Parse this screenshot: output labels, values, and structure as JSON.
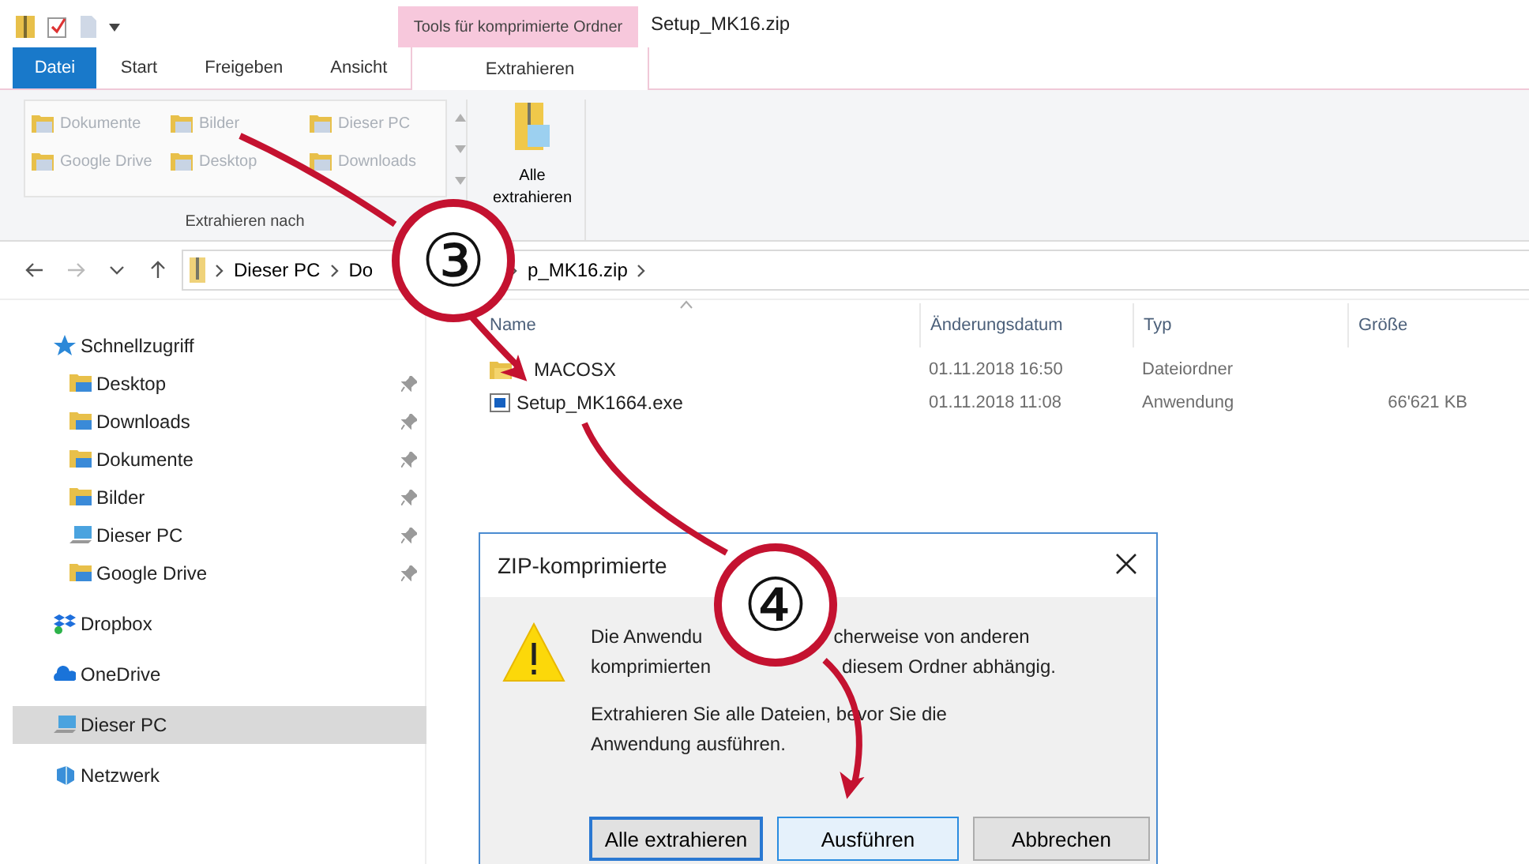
{
  "ribbon": {
    "context_header": "Tools für komprimierte Ordner",
    "window_title": "Setup_MK16.zip",
    "tabs": [
      {
        "label": "Datei",
        "kind": "file",
        "selected": false
      },
      {
        "label": "Start",
        "kind": "tab",
        "selected": false
      },
      {
        "label": "Freigeben",
        "kind": "tab",
        "selected": false
      },
      {
        "label": "Ansicht",
        "kind": "tab",
        "selected": false
      },
      {
        "label": "Extrahieren",
        "kind": "context",
        "selected": true
      }
    ],
    "gallery_items": [
      {
        "label": "Dokumente",
        "disabled": true
      },
      {
        "label": "Bilder",
        "disabled": true
      },
      {
        "label": "Dieser PC",
        "disabled": true
      },
      {
        "label": "Google Drive",
        "disabled": true
      },
      {
        "label": "Desktop",
        "disabled": true
      },
      {
        "label": "Downloads",
        "disabled": true
      }
    ],
    "group_label": "Extrahieren nach",
    "extract_all": "Alle extrahieren"
  },
  "address_bar": {
    "segments": [
      "Dieser PC",
      "Do",
      "p_MK16.zip"
    ]
  },
  "sidebar": {
    "items": [
      {
        "label": "Schnellzugriff",
        "kind": "star",
        "selected": false,
        "children": [
          {
            "label": "Desktop",
            "kind": "folder",
            "pinned": true,
            "selected": false
          },
          {
            "label": "Downloads",
            "kind": "folder",
            "pinned": true,
            "selected": false
          },
          {
            "label": "Dokumente",
            "kind": "folder",
            "pinned": true,
            "selected": false
          },
          {
            "label": "Bilder",
            "kind": "folder",
            "pinned": true,
            "selected": false
          },
          {
            "label": "Dieser PC",
            "kind": "pc",
            "pinned": true,
            "selected": false
          },
          {
            "label": "Google Drive",
            "kind": "folder",
            "pinned": true,
            "selected": false
          }
        ]
      },
      {
        "label": "Dropbox",
        "kind": "dropbox",
        "selected": false
      },
      {
        "label": "OneDrive",
        "kind": "cloud",
        "selected": false
      },
      {
        "label": "Dieser PC",
        "kind": "pc",
        "selected": true
      },
      {
        "label": "Netzwerk",
        "kind": "network",
        "selected": false
      }
    ]
  },
  "file_list": {
    "columns": [
      "Name",
      "Änderungsdatum",
      "Typ",
      "Größe"
    ],
    "rows": [
      {
        "name": "MACOSX",
        "kind": "folder",
        "date": "01.11.2018 16:50",
        "type": "Dateiordner"
      },
      {
        "name": "Setup_MK1664.exe",
        "kind": "app",
        "date": "01.11.2018 11:08",
        "type": "Anwendung",
        "size": "66'621 KB"
      }
    ]
  },
  "dialog": {
    "title": "ZIP-komprimierte",
    "line_1": [
      "Die Anwendu",
      "cherweise von anderen"
    ],
    "line_2": [
      "komprimierten",
      "diesem Ordner abhängig."
    ],
    "paragraph_2": "Extrahieren Sie alle Dateien, bevor Sie die Anwendung ausführen.",
    "buttons": [
      {
        "label": "Alle extrahieren",
        "default": true,
        "hovered": false
      },
      {
        "label": "Ausführen",
        "default": false,
        "hovered": true
      },
      {
        "label": "Abbrechen",
        "default": false,
        "hovered": false
      }
    ]
  },
  "annotations": [
    {
      "number": "③"
    },
    {
      "number": "④"
    }
  ]
}
